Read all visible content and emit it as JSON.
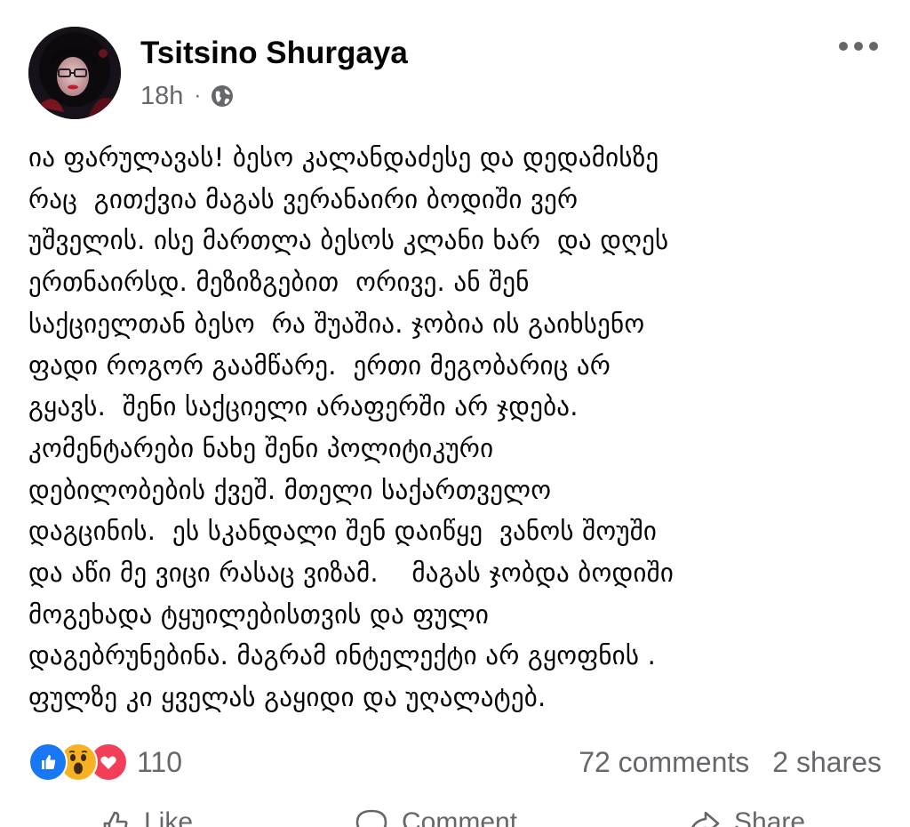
{
  "post": {
    "author": "Tsitsino Shurgaya",
    "timestamp": "18h",
    "separator": "·",
    "privacy_icon": "globe-icon",
    "more_icon": "more-options-icon",
    "text_lines": [
      "ია ფარულავას! ბესო კალანდაძესე და დედამისზე",
      "რაც  გითქვია მაგას ვერანაირი ბოდიში ვერ",
      "უშველის. ისე მართლა ბესოს კლანი ხარ  და დღეს",
      "ერთნაირსდ. მეზიზგებით  ორივე. ან შენ",
      "საქციელთან ბესო  რა შუაშია. ჯობია ის გაიხსენო",
      "ფადი როგორ გაამწარე.  ერთი მეგობარიც არ",
      "გყავს.  შენი საქციელი არაფერში არ ჯდება.",
      "კომენტარები ნახე შენი პოლიტიკური",
      "დებილობების ქვეშ. მთელი საქართველო",
      "დაგცინის.  ეს სკანდალი შენ დაიწყე  ვანოს შოუში",
      "და აწი მე ვიცი რასაც ვიზამ.    მაგას ჯობდა ბოდიში",
      "მოგეხადა ტყუილებისთვის და ფული",
      "დაგებრუნებინა. მაგრამ ინტელექტი არ გყოფნის .",
      "ფულზე კი ყველას გაყიდი და უღალატებ."
    ]
  },
  "stats": {
    "reaction_icons": [
      "like-icon",
      "wow-icon",
      "love-icon"
    ],
    "reaction_count": "110",
    "comments": "72 comments",
    "shares": "2 shares"
  },
  "actions": {
    "like_label": "Like",
    "comment_label": "Comment",
    "share_label": "Share"
  },
  "colors": {
    "like_blue": "#1877f2",
    "wow_yellow": "#f7b125",
    "love_red": "#f33e58",
    "secondary_text": "#65676b",
    "primary_text": "#050505"
  }
}
